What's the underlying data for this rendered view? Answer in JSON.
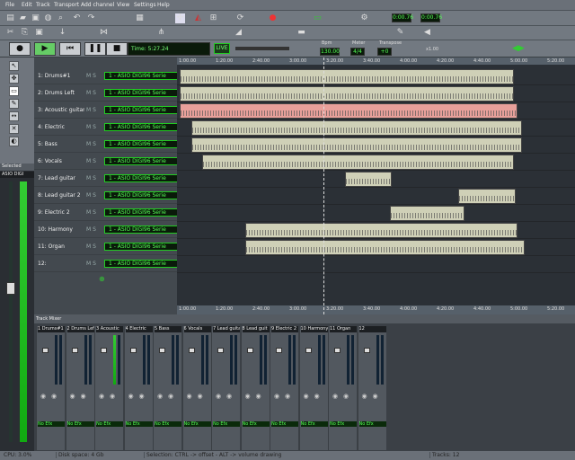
{
  "menu": [
    "File",
    "Edit",
    "Track",
    "Transport",
    "Add channel",
    "View",
    "Settings",
    "Help"
  ],
  "toolbar": {
    "time1": "0:00.76",
    "time2": "0:00.76"
  },
  "transport": {
    "time": "Time: 5:27.24",
    "live": "LIVE",
    "bpm_label": "Bpm",
    "bpm": "130.00",
    "meter_label": "Meter",
    "meter": "4/4",
    "transpose_label": "Transpose",
    "transpose": "+0",
    "zoom": "x1.00"
  },
  "panels": {
    "selected": "Selected",
    "track_mixer": "Track Mixer",
    "selected_input": "ASIO DIGI"
  },
  "tracks": [
    {
      "name": "1: Drums#1",
      "input": "1 - ASIO DIGI96 Serie",
      "color": "#cfd0b7"
    },
    {
      "name": "2: Drums Left",
      "input": "1 - ASIO DIGI96 Serie",
      "color": "#cfd0b7"
    },
    {
      "name": "3: Acoustic guitar",
      "input": "1 - ASIO DIGI96 Serie",
      "color": "#e8a09a"
    },
    {
      "name": "4: Electric",
      "input": "1 - ASIO DIGI96 Serie",
      "color": "#cfd0b7"
    },
    {
      "name": "5: Bass",
      "input": "1 - ASIO DIGI96 Serie",
      "color": "#cfd0b7"
    },
    {
      "name": "6: Vocals",
      "input": "1 - ASIO DIGI96 Serie",
      "color": "#cfd0b7"
    },
    {
      "name": "7: Lead guitar",
      "input": "1 - ASIO DIGI96 Serie",
      "color": "#cfd0b7"
    },
    {
      "name": "8: Lead guitar 2",
      "input": "1 - ASIO DIGI96 Serie",
      "color": "#cfd0b7"
    },
    {
      "name": "9: Electric 2",
      "input": "1 - ASIO DIGI96 Serie",
      "color": "#cfd0b7"
    },
    {
      "name": "10: Harmony",
      "input": "1 - ASIO DIGI96 Serie",
      "color": "#cfd0b7"
    },
    {
      "name": "11: Organ",
      "input": "1 - ASIO DIGI96 Serie",
      "color": "#cfd0b7"
    },
    {
      "name": "12:",
      "input": "1 - ASIO DIGI96 Serie",
      "color": "#cfd0b7"
    }
  ],
  "ruler": [
    "1:00.00",
    "1:20.00",
    "2:40.00",
    "3:00.00",
    "3:20.00",
    "3:40.00",
    "4:00.00",
    "4:20.00",
    "4:40.00",
    "5:00.00",
    "5:20.00"
  ],
  "mixer_channels": [
    "1 Drums#1",
    "2 Drums Left",
    "3 Acoustic",
    "4 Electric",
    "5 Bass",
    "6 Vocals",
    "7 Lead guitar",
    "8 Lead guit",
    "9 Electric 2",
    "10 Harmony",
    "11 Organ",
    "12"
  ],
  "mixer_noefx": "No Efx",
  "status": {
    "cpu": "CPU: 3.0%",
    "disk": "Disk space: 4 Gb",
    "hint": "Selection: CTRL -> offset - ALT -> volume drawing",
    "tracks": "Tracks: 12"
  }
}
